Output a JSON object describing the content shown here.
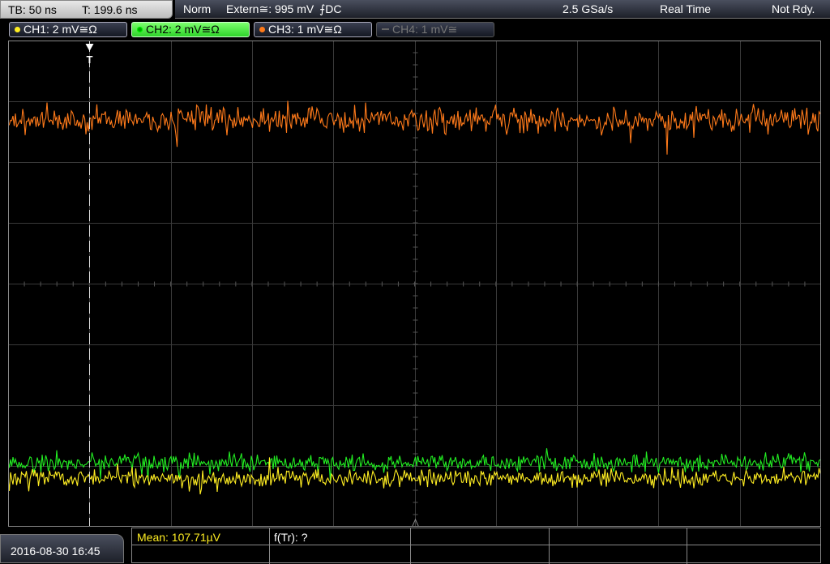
{
  "timebase": {
    "tb_label": "TB: 50 ns",
    "trigger_time_label": "T: 199.6 ns"
  },
  "status": {
    "trigger_mode": "Norm",
    "trigger_source": "Extern≅: 995 mV",
    "trigger_slope": "⨍DC",
    "sample_rate": "2.5 GSa/s",
    "acq_mode": "Real Time",
    "ready_state": "Not Rdy."
  },
  "channels": [
    {
      "label": "CH1: 2 mV≅Ω",
      "color": "#ffee22",
      "state": "on"
    },
    {
      "label": "CH2: 2 mV≅Ω",
      "color": "#22ee22",
      "state": "active"
    },
    {
      "label": "CH3: 1 mV≅Ω",
      "color": "#ff7a1a",
      "state": "on"
    },
    {
      "label": "CH4: 1 mV≅",
      "color": "#666666",
      "state": "off"
    }
  ],
  "chart_data": {
    "type": "line",
    "grid": true,
    "divisions_x": 10,
    "divisions_y": 8,
    "trigger_marker": "T",
    "series": [
      {
        "channel": "CH3",
        "color": "#ff7a1a",
        "level_div": 1.3,
        "noise_div": 0.22
      },
      {
        "channel": "CH2",
        "color": "#22ee22",
        "level_div": 6.95,
        "noise_div": 0.14
      },
      {
        "channel": "CH1",
        "color": "#ffee22",
        "level_div": 7.2,
        "noise_div": 0.15
      }
    ]
  },
  "footer": {
    "datetime": "2016-08-30 16:45",
    "mean_label": "Mean: 107.71µV",
    "freq_label": "f(Tr): ?"
  }
}
